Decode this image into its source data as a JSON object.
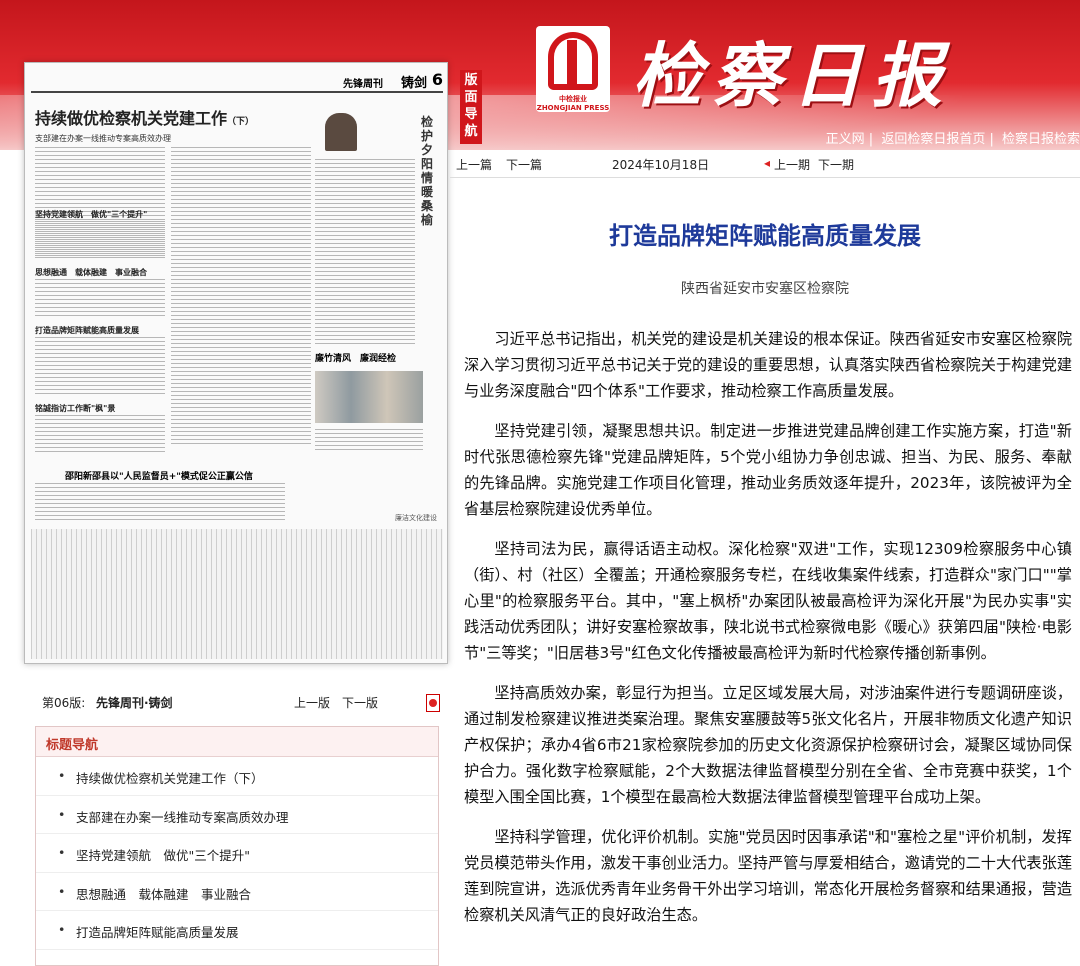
{
  "header": {
    "masthead": "检察日报",
    "logo_text": "中检报业",
    "logo_sub": "ZHONGJIAN PRESS",
    "guide_tab": "版面导航",
    "links": [
      "正义网",
      "返回检察日报首页",
      "检察日报检索"
    ]
  },
  "paper_thumb": {
    "section_label": "先锋周刊",
    "column_label": "铸剑",
    "page_number": "6",
    "headline": "持续做优检察机关党建工作",
    "headline_suffix": "（下）",
    "subhead": "支部建在办案一线推动专案高质效办理",
    "sec1": "坚持党建领航　做优\"三个提升\"",
    "sec2": "思想融通　载体融建　事业融合",
    "sec3": "打造品牌矩阵赋能高质量发展",
    "sec4": "铭誠指访工作断\"枫\"景",
    "vertical_head": "检护夕阳　情暖桑榆",
    "side_head": "廉竹清风　廉润经检",
    "bottom_head": "邵阳新邵县以\"人民监督员+\"模式促公正赢公信",
    "stamp": "廉洁文化建设"
  },
  "page_bar": {
    "label": "第06版:",
    "page_name": "先锋周刊·铸剑",
    "prev": "上一版",
    "next": "下一版"
  },
  "title_nav": {
    "heading": "标题导航",
    "items": [
      "持续做优检察机关党建工作（下）",
      "支部建在办案一线推动专案高质效办理",
      "坚持党建领航　做优\"三个提升\"",
      "思想融通　载体融建　事业融合",
      "打造品牌矩阵赋能高质量发展"
    ]
  },
  "article_nav": {
    "prev_article": "上一篇",
    "next_article": "下一篇",
    "date": "2024年10月18日",
    "prev_issue": "上一期",
    "next_issue": "下一期"
  },
  "article": {
    "title": "打造品牌矩阵赋能高质量发展",
    "author": "陕西省延安市安塞区检察院",
    "paragraphs": [
      "习近平总书记指出，机关党的建设是机关建设的根本保证。陕西省延安市安塞区检察院深入学习贯彻习近平总书记关于党的建设的重要思想，认真落实陕西省检察院关于构建党建与业务深度融合\"四个体系\"工作要求，推动检察工作高质量发展。",
      "坚持党建引领，凝聚思想共识。制定进一步推进党建品牌创建工作实施方案，打造\"新时代张思德检察先锋\"党建品牌矩阵，5个党小组协力争创忠诚、担当、为民、服务、奉献的先锋品牌。实施党建工作项目化管理，推动业务质效逐年提升，2023年，该院被评为全省基层检察院建设优秀单位。",
      "坚持司法为民，赢得话语主动权。深化检察\"双进\"工作，实现12309检察服务中心镇（街）、村（社区）全覆盖；开通检察服务专栏，在线收集案件线索，打造群众\"家门口\"\"掌心里\"的检察服务平台。其中，\"塞上枫桥\"办案团队被最高检评为深化开展\"为民办实事\"实践活动优秀团队；讲好安塞检察故事，陕北说书式检察微电影《暖心》获第四届\"陕检·电影节\"三等奖；\"旧居巷3号\"红色文化传播被最高检评为新时代检察传播创新事例。",
      "坚持高质效办案，彰显行为担当。立足区域发展大局，对涉油案件进行专题调研座谈，通过制发检察建议推进类案治理。聚焦安塞腰鼓等5张文化名片，开展非物质文化遗产知识产权保护；承办4省6市21家检察院参加的历史文化资源保护检察研讨会，凝聚区域协同保护合力。强化数字检察赋能，2个大数据法律监督模型分别在全省、全市竞赛中获奖，1个模型入围全国比赛，1个模型在最高检大数据法律监督模型管理平台成功上架。",
      "坚持科学管理，优化评价机制。实施\"党员因时因事承诺\"和\"塞检之星\"评价机制，发挥党员模范带头作用，激发干事创业活力。坚持严管与厚爱相结合，邀请党的二十大代表张莲莲到院宣讲，选派优秀青年业务骨干外出学习培训，常态化开展检务督察和结果通报，营造检察机关风清气正的良好政治生态。"
    ]
  }
}
